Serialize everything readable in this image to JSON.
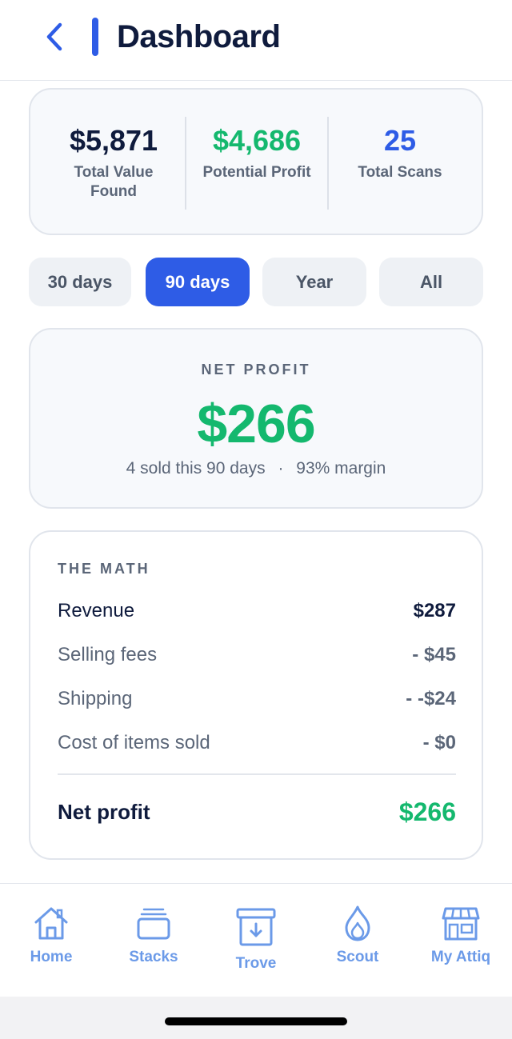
{
  "header": {
    "title": "Dashboard",
    "back_icon": "chevron-left-icon"
  },
  "stats": [
    {
      "value": "$5,871",
      "label": "Total Value Found",
      "color": "#0f1b3d"
    },
    {
      "value": "$4,686",
      "label": "Potential Profit",
      "color": "#14b86e"
    },
    {
      "value": "25",
      "label": "Total Scans",
      "color": "#2e5ce6"
    }
  ],
  "range_tabs": [
    {
      "label": "30 days",
      "active": false
    },
    {
      "label": "90 days",
      "active": true
    },
    {
      "label": "Year",
      "active": false
    },
    {
      "label": "All",
      "active": false
    }
  ],
  "net_profit": {
    "label": "NET PROFIT",
    "value": "$266",
    "sold_text": "4 sold this 90 days",
    "separator": "·",
    "margin_text": "93% margin"
  },
  "math": {
    "label": "THE MATH",
    "rows": [
      {
        "label": "Revenue",
        "value": "$287"
      },
      {
        "label": "Selling fees",
        "value": "- $45"
      },
      {
        "label": "Shipping",
        "value": "- -$24"
      },
      {
        "label": "Cost of items sold",
        "value": "- $0"
      }
    ],
    "total_label": "Net profit",
    "total_value": "$266"
  },
  "tabbar": [
    {
      "label": "Home",
      "icon": "home-icon"
    },
    {
      "label": "Stacks",
      "icon": "stacks-icon"
    },
    {
      "label": "Trove",
      "icon": "archive-box-icon"
    },
    {
      "label": "Scout",
      "icon": "flame-icon"
    },
    {
      "label": "My Attiq",
      "icon": "storefront-icon"
    }
  ],
  "colors": {
    "accent": "#2e5ce6",
    "profit_green": "#14b86e",
    "nav_blue": "#6b9ae8",
    "text_dark": "#0f1b3d",
    "text_muted": "#5b6678"
  }
}
